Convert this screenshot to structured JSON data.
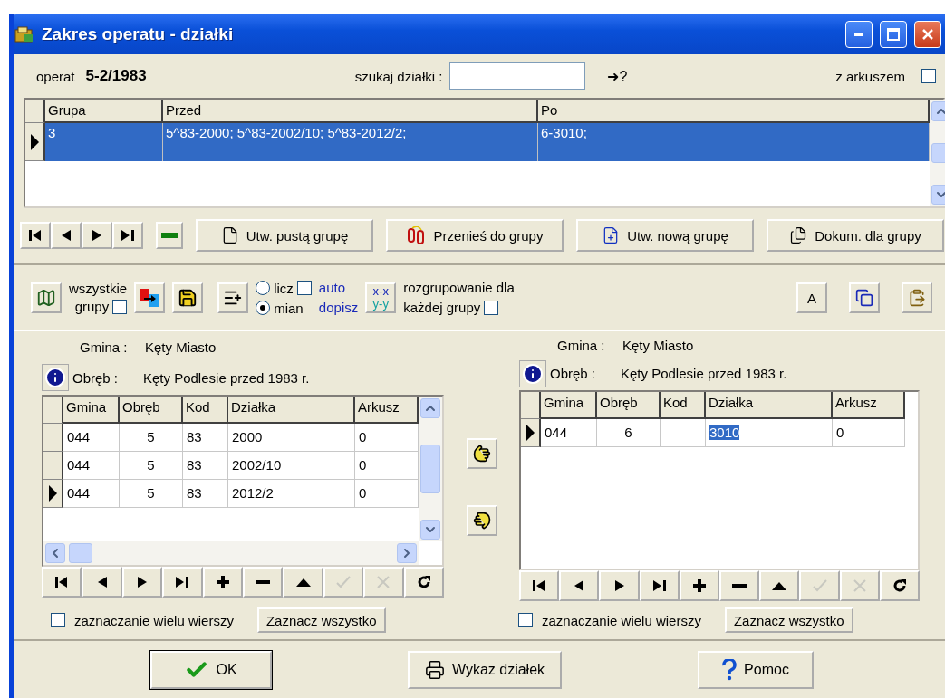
{
  "window": {
    "title": "Zakres operatu - działki"
  },
  "header": {
    "operat_label": "operat",
    "operat_value": "5-2/1983",
    "search_label": "szukaj działki :",
    "go_label": "➜?",
    "z_arkuszem": {
      "label": "z arkuszem",
      "checked": false
    }
  },
  "groups_table": {
    "columns": [
      "Grupa",
      "Przed",
      "Po"
    ],
    "rows": [
      {
        "cells": [
          "3",
          "5^83-2000;  5^83-2002/10;  5^83-2012/2;",
          "6-3010;"
        ],
        "selected": true,
        "current": true
      }
    ]
  },
  "group_toolbar": {
    "navigator": [
      {
        "kind": "first"
      },
      {
        "kind": "prev"
      },
      {
        "kind": "next"
      },
      {
        "kind": "last"
      }
    ],
    "buttons": [
      {
        "kind": "blank-doc",
        "label": "Utw. pustą grupę"
      },
      {
        "kind": "move",
        "label": "Przenieś do grupy"
      },
      {
        "kind": "new-doc",
        "label": "Utw. nową grupę"
      },
      {
        "kind": "docs",
        "label": "Dokum. dla grupy"
      }
    ]
  },
  "options": {
    "all_groups": {
      "label_1": "wszystkie",
      "label_2": "grupy",
      "checked": false
    },
    "radios": [
      {
        "label": "licz",
        "selected": false
      },
      {
        "label": "mian",
        "selected": true
      }
    ],
    "auto_dopisz": {
      "label_1": "auto",
      "label_2": "dopisz",
      "checked": false
    },
    "xy_button": {
      "line_1": "x-x",
      "line_2": "y-y"
    },
    "ungroup": {
      "label_1": "rozgrupowanie dla",
      "label_2": "każdej grupy",
      "checked": false
    },
    "font_button": "A"
  },
  "panels": [
    {
      "gmina_label": "Gmina :",
      "gmina": "Kęty Miasto",
      "obreb_label": "Obręb :",
      "obreb": "Kęty Podlesie przed 1983 r.",
      "columns": [
        "Gmina",
        "Obręb",
        "Kod",
        "Działka",
        "Arkusz"
      ],
      "scrollbars": true,
      "rows": [
        {
          "current": false,
          "cells": [
            {
              "text": "044",
              "selected": false
            },
            {
              "text": "5",
              "selected": false
            },
            {
              "text": "83",
              "selected": false
            },
            {
              "text": "2000",
              "selected": false
            },
            {
              "text": "0",
              "selected": false
            }
          ]
        },
        {
          "current": false,
          "cells": [
            {
              "text": "044",
              "selected": false
            },
            {
              "text": "5",
              "selected": false
            },
            {
              "text": "83",
              "selected": false
            },
            {
              "text": "2002/10",
              "selected": false
            },
            {
              "text": "0",
              "selected": false
            }
          ]
        },
        {
          "current": true,
          "cells": [
            {
              "text": "044",
              "selected": false
            },
            {
              "text": "5",
              "selected": false
            },
            {
              "text": "83",
              "selected": false
            },
            {
              "text": "2012/2",
              "selected": false
            },
            {
              "text": "0",
              "selected": false
            }
          ]
        }
      ],
      "multi_select": {
        "label": "zaznaczanie wielu wierszy",
        "checked": false
      },
      "select_all": "Zaznacz wszystko"
    },
    {
      "gmina_label": "Gmina :",
      "gmina": "Kęty Miasto",
      "obreb_label": "Obręb :",
      "obreb": "Kęty Podlesie przed 1983 r.",
      "columns": [
        "Gmina",
        "Obręb",
        "Kod",
        "Działka",
        "Arkusz"
      ],
      "scrollbars": false,
      "rows": [
        {
          "current": true,
          "cells": [
            {
              "text": "044",
              "selected": false
            },
            {
              "text": "6",
              "selected": false
            },
            {
              "text": "",
              "selected": false
            },
            {
              "text": "3010",
              "selected": true
            },
            {
              "text": "0",
              "selected": false
            }
          ]
        }
      ],
      "multi_select": {
        "label": "zaznaczanie wielu wierszy",
        "checked": false
      },
      "select_all": "Zaznacz wszystko"
    }
  ],
  "navigator": [
    {
      "kind": "first",
      "disabled": false
    },
    {
      "kind": "prev",
      "disabled": false
    },
    {
      "kind": "next",
      "disabled": false
    },
    {
      "kind": "last",
      "disabled": false
    },
    {
      "kind": "add",
      "disabled": false
    },
    {
      "kind": "delete",
      "disabled": false
    },
    {
      "kind": "edit",
      "disabled": false
    },
    {
      "kind": "post",
      "disabled": true
    },
    {
      "kind": "cancel",
      "disabled": true
    },
    {
      "kind": "refresh",
      "disabled": false
    }
  ],
  "footer": [
    {
      "kind": "ok",
      "label": "OK"
    },
    {
      "kind": "print",
      "label": "Wykaz działek"
    },
    {
      "kind": "help",
      "label": "Pomoc"
    }
  ]
}
